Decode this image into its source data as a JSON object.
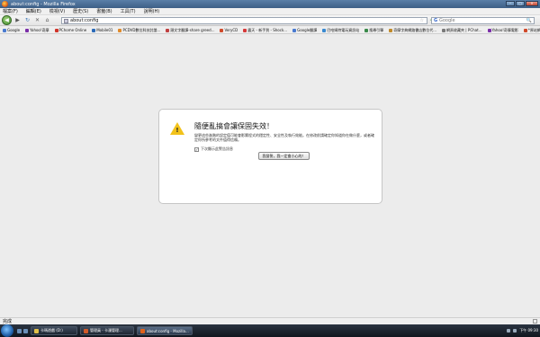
{
  "window": {
    "title": "about:config - Mozilla Firefox",
    "minimize": "–",
    "maximize": "□",
    "close": "×"
  },
  "menu": [
    "檔案(F)",
    "編輯(E)",
    "檢視(V)",
    "歷史(S)",
    "書籤(B)",
    "工具(T)",
    "說明(H)"
  ],
  "nav": {
    "back": "◀",
    "forward": "▶",
    "reload": "↻",
    "stop": "✕",
    "home": "⌂",
    "url": "about:config",
    "star": "☆",
    "go": "➜",
    "search_engine": "G",
    "search_placeholder": "Google",
    "search_icon": "🔍"
  },
  "bookmarks": [
    {
      "label": "Google",
      "color": "#4a7bd0"
    },
    {
      "label": "Yahoo!奇摩",
      "color": "#7b2fa8"
    },
    {
      "label": "PChome Online",
      "color": "#d0342a"
    },
    {
      "label": "Mobile01",
      "color": "#2a6ab8"
    },
    {
      "label": "PCDVD數位科技討論...",
      "color": "#e08a2a"
    },
    {
      "label": "頭文字翻譯-share greed...",
      "color": "#c04040"
    },
    {
      "label": "VeryCD",
      "color": "#d04a2a"
    },
    {
      "label": "露天 - 新手到 - Shock...",
      "color": "#d63a3a"
    },
    {
      "label": "Google翻譯",
      "color": "#4a7bd0"
    },
    {
      "label": "巴哈姆特電玩資訊站",
      "color": "#3a8ad0"
    },
    {
      "label": "搜尋引擎",
      "color": "#3a8a4a"
    },
    {
      "label": "奇摩字典網路書店數位代...",
      "color": "#c08a2a"
    },
    {
      "label": "網頁收藏夾 | PChat...",
      "color": "#7a7a7a"
    },
    {
      "label": "Yahoo!奇摩電影",
      "color": "#7b2fa8"
    },
    {
      "label": "*原站網",
      "color": "#d04a2a"
    }
  ],
  "dialog": {
    "title": "隨便亂搞會讓保固失效！",
    "body": "變更這些進階的設定值可能會影響程式的穩定性、安全性及執行效能。在修改前請確定你知道你在做什麼，或者確定你所參考的文件值得信賴。",
    "checkbox_label": "下次顯示此警告訊息",
    "checkbox_checked": "✓",
    "button": "我發誓，我一定會小心的！",
    "warning_mark": "!"
  },
  "status": {
    "text": "完成"
  },
  "taskbar": {
    "items": [
      {
        "label": "卡瑪遊戲 (D:)",
        "color": "#e0c04a",
        "active": false
      },
      {
        "label": "管理員 - 卡漫管理...",
        "color": "#d05a2a",
        "active": false
      },
      {
        "label": "about:config - Mozilla...",
        "color": "#e0621b",
        "active": true
      }
    ],
    "clock": "下午 09:30"
  }
}
